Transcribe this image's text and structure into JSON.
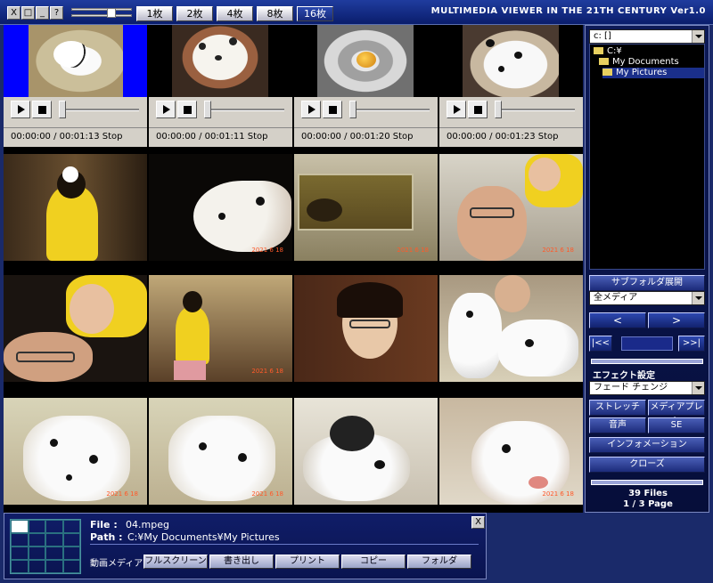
{
  "titlebar": {
    "close_glyph": "X",
    "restore_glyph": "□",
    "minimize_glyph": "_",
    "help_glyph": "?",
    "layouts": [
      "1枚",
      "2枚",
      "4枚",
      "8枚",
      "16枚"
    ],
    "active_layout": "16枚",
    "app_title": "MULTIMEDIA VIEWER IN THE 21TH CENTURY Ver1.0"
  },
  "videos": [
    {
      "time": "00:00:00 / 00:01:13 Stop"
    },
    {
      "time": "00:00:00 / 00:01:11 Stop"
    },
    {
      "time": "00:00:00 / 00:01:20 Stop"
    },
    {
      "time": "00:00:00 / 00:01:23 Stop"
    }
  ],
  "photo_stamp": "2021 6 18",
  "sidebar": {
    "drive": "c: []",
    "tree": [
      {
        "label": "C:¥",
        "selected": false
      },
      {
        "label": "My Documents",
        "selected": false
      },
      {
        "label": "My Pictures",
        "selected": true
      }
    ],
    "subfolder_button": "サブフォルダ展開",
    "media_filter": "全メディア",
    "prev_glyph": "<",
    "next_glyph": ">",
    "first_glyph": "|<<",
    "last_glyph": ">>|",
    "effect_label": "エフェクト設定",
    "effect_value": "フェード チェンジ",
    "stretch_button": "ストレッチ",
    "media_player_button": "メディアプレーヤー",
    "sound_button": "音声",
    "se_button": "SE",
    "info_button": "インフォメーション",
    "close_button": "クローズ",
    "file_count": "39 Files",
    "page": "1 / 3 Page"
  },
  "bottom": {
    "file_label": "File :",
    "file_value": "04.mpeg",
    "path_label": "Path :",
    "path_value": "C:¥My Documents¥My Pictures",
    "media_label": "動画メディア",
    "close_glyph": "X",
    "actions": [
      "フルスクリーン",
      "書き出し",
      "プリント",
      "コピー",
      "フォルダ"
    ]
  }
}
